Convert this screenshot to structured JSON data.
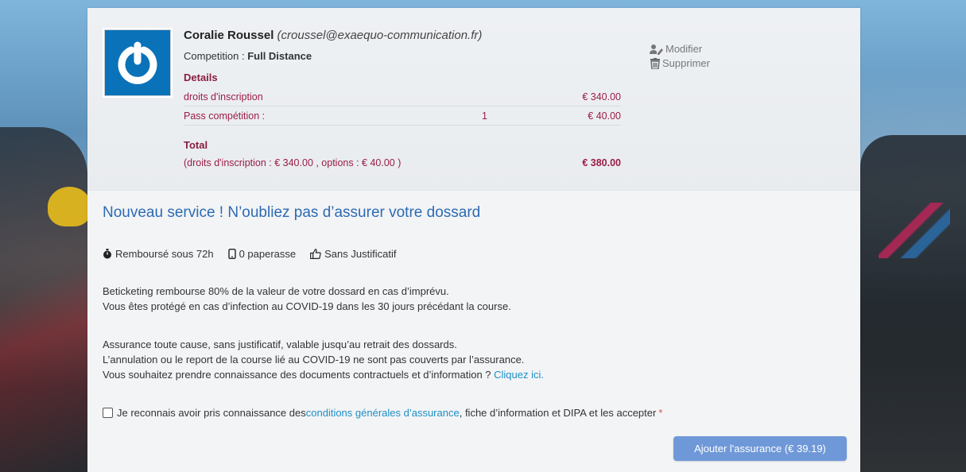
{
  "participant": {
    "name": "Coralie Roussel",
    "email": "(croussel@exaequo-communication.fr)",
    "competition_label": "Competition : ",
    "competition_value": "Full Distance",
    "avatar_icon": "power-icon",
    "avatar_color": "#0a72b8"
  },
  "details": {
    "title": "Details",
    "rows": [
      {
        "label": "droits d'inscription",
        "qty": "",
        "amount": "€ 340.00"
      },
      {
        "label": "Pass compétition :",
        "qty": "1",
        "amount": "€ 40.00"
      }
    ]
  },
  "total": {
    "title": "Total",
    "breakdown": "(droits d'inscription : € 340.00 , options : € 40.00 )",
    "amount": "€ 380.00"
  },
  "actions": {
    "modify_label": "Modifier",
    "modify_icon": "user-edit-icon",
    "delete_label": "Supprimer",
    "delete_icon": "trash-icon"
  },
  "insurance": {
    "title": "Nouveau service ! N’oubliez pas d’assurer votre dossard",
    "features": [
      {
        "icon": "stopwatch-icon",
        "label": "Remboursé sous 72h"
      },
      {
        "icon": "mobile-icon",
        "label": "0 paperasse"
      },
      {
        "icon": "thumbs-up-icon",
        "label": "Sans Justificatif"
      }
    ],
    "paragraph1": [
      "Beticketing rembourse 80% de la valeur de votre dossard en cas d’imprévu.",
      "Vous êtes protégé en cas d’infection au COVID-19 dans les 30 jours précédant la course."
    ],
    "paragraph2": [
      "Assurance toute cause, sans justificatif, valable jusqu’au retrait des dossards.",
      "L’annulation ou le report de la course lié au COVID-19 ne sont pas couverts par l’assurance."
    ],
    "paragraph2_line3_prefix": "Vous souhaitez prendre connaissance des documents contractuels et d’information ? ",
    "paragraph2_link": "Cliquez ici.",
    "consent_prefix": "Je reconnais avoir pris connaissance des ",
    "consent_link": "conditions générales d’assurance",
    "consent_suffix": ", fiche d’information et DIPA et les accepter",
    "consent_required_mark": "*",
    "consent_checked": false,
    "add_button_label": "Ajouter l'assurance (€ 39.19)",
    "title_color": "#2c6bb3",
    "link_color": "#1e8fc7",
    "button_color": "#6f98d8",
    "price_color": "#9b1d45"
  }
}
